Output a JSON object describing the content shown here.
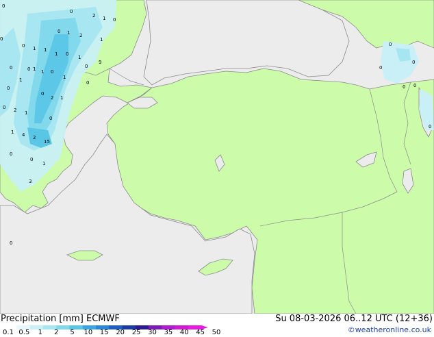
{
  "map": {
    "colors": {
      "sea": "#ececec",
      "land": "#ccfcaa",
      "border": "#8a8a8a",
      "coast": "#8a8a8a"
    },
    "precip_labels": [
      "0",
      "2",
      "1",
      "0",
      "0",
      "1",
      "2",
      "1",
      "0",
      "1",
      "0",
      "1",
      "1",
      "0",
      "0",
      "1",
      "0",
      "0",
      "0",
      "1",
      "1",
      "9",
      "1",
      "0",
      "1",
      "2",
      "0",
      "1",
      "0",
      "0",
      "2",
      "0",
      "1",
      "4",
      "2",
      "15",
      "1",
      "1",
      "3",
      "0",
      "0",
      "0",
      "0",
      "0",
      "0",
      "0",
      "0",
      "0",
      "0"
    ]
  },
  "footer": {
    "title": "Precipitation [mm]  ECMWF",
    "datetime": "Su 08-03-2026 06..12 UTC (12+36)",
    "credit": "©weatheronline.co.uk",
    "legend": {
      "ticks": [
        "0.1",
        "0.5",
        "1",
        "2",
        "5",
        "10",
        "15",
        "20",
        "25",
        "30",
        "35",
        "40",
        "45",
        "50"
      ],
      "colors": [
        "#e6f8fb",
        "#c8f0f6",
        "#a6e6f0",
        "#80d8ea",
        "#5ac6e6",
        "#3aa6e2",
        "#2a86d6",
        "#1c5ec6",
        "#1a3aa6",
        "#2a1a96",
        "#7a1aba",
        "#b01ad2",
        "#d21ad6",
        "#e61ae0"
      ]
    }
  }
}
